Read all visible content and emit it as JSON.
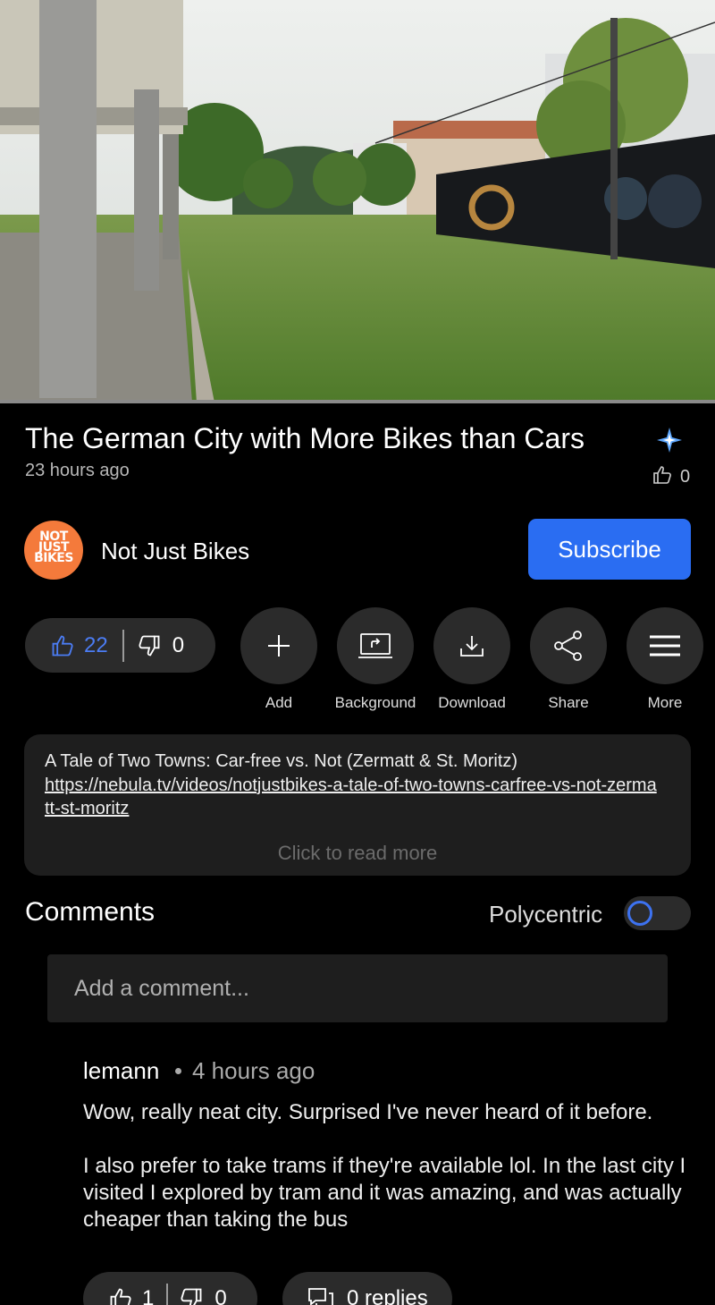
{
  "video": {
    "title": "The German City with More Bikes than Cars",
    "posted": "23 hours ago",
    "title_likes": "0"
  },
  "channel": {
    "logo_text": "NOT JUST BIKES",
    "name": "Not Just Bikes",
    "subscribe_label": "Subscribe"
  },
  "actions": {
    "likes": "22",
    "dislikes": "0",
    "add": "Add",
    "background": "Background",
    "download": "Download",
    "share": "Share",
    "more": "More"
  },
  "description": {
    "line1": "A Tale of Two Towns: Car-free vs. Not (Zermatt & St. Moritz)",
    "link": "https://nebula.tv/videos/notjustbikes-a-tale-of-two-towns-carfree-vs-not-zermatt-st-moritz",
    "read_more": "Click to read more"
  },
  "comments": {
    "header": "Comments",
    "source_label": "Polycentric",
    "input_placeholder": "Add a comment...",
    "items": [
      {
        "author": "lemann",
        "time": "4 hours ago",
        "paragraph1": "Wow, really neat city. Surprised I've never heard of it before.",
        "paragraph2": "I also prefer to take trams if they're available lol. In the last city I visited I explored by tram and it was amazing, and was actually cheaper than taking the bus",
        "likes": "1",
        "dislikes": "0",
        "replies": "0 replies"
      }
    ]
  },
  "colors": {
    "accent": "#2a6df2",
    "like_blue": "#4b7cf3",
    "avatar_orange": "#f47a3b",
    "surface": "#2b2b2b",
    "background": "#000000"
  }
}
